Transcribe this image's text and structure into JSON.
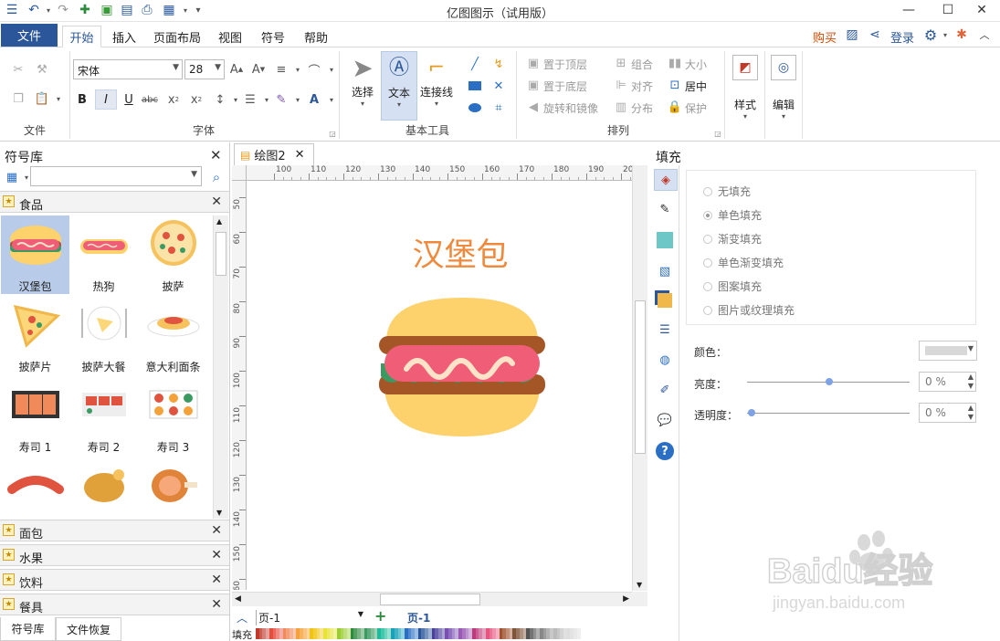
{
  "app": {
    "title": "亿图图示（试用版）"
  },
  "ribbon_tabs": [
    {
      "label": "文件"
    },
    {
      "label": "开始"
    },
    {
      "label": "插入"
    },
    {
      "label": "页面布局"
    },
    {
      "label": "视图"
    },
    {
      "label": "符号"
    },
    {
      "label": "帮助"
    }
  ],
  "header_right": {
    "buy": "购买",
    "login": "登录"
  },
  "groups": {
    "file": "文件",
    "font": "字体",
    "basic_tools": "基本工具",
    "arrange": "排列"
  },
  "font": {
    "family": "宋体",
    "size": "28"
  },
  "tools": {
    "select": "选择",
    "text": "文本",
    "connector": "连接线"
  },
  "arrange": {
    "bring_front": "置于顶层",
    "send_back": "置于底层",
    "rotate": "旋转和镜像",
    "group": "组合",
    "align": "对齐",
    "distribute": "分布",
    "size": "大小",
    "center": "居中",
    "protect": "保护"
  },
  "style_label": "样式",
  "edit_label": "编辑",
  "symbol_library": {
    "title": "符号库",
    "open_category": "食品",
    "items": [
      "汉堡包",
      "热狗",
      "披萨",
      "披萨片",
      "披萨大餐",
      "意大利面条",
      "寿司 1",
      "寿司 2",
      "寿司 3"
    ],
    "collapsed_categories": [
      "面包",
      "水果",
      "饮料",
      "餐具"
    ],
    "bottom_tabs": [
      "符号库",
      "文件恢复"
    ]
  },
  "document": {
    "tab": "绘图2",
    "canvas_title": "汉堡包",
    "ruler_h": [
      "100",
      "110",
      "120",
      "130",
      "140",
      "150",
      "160",
      "170",
      "180",
      "190",
      "200"
    ],
    "ruler_v": [
      "50",
      "60",
      "70",
      "80",
      "90",
      "100",
      "110",
      "120",
      "130",
      "140",
      "150",
      "160"
    ]
  },
  "pagebar": {
    "page_select": "页-1",
    "page_tab": "页-1",
    "fill_label": "填充"
  },
  "fill_panel": {
    "title": "填充",
    "options": [
      "无填充",
      "单色填充",
      "渐变填充",
      "单色渐变填充",
      "图案填充",
      "图片或纹理填充"
    ],
    "selected_option": "单色填充",
    "color_label": "颜色：",
    "brightness_label": "亮度：",
    "brightness_value": "0 %",
    "transparency_label": "透明度：",
    "transparency_value": "0 %"
  },
  "colors": {
    "accent": "#2b579a",
    "buy": "#d04a02",
    "canvas_title": "#ef8a3d",
    "bun": "#fdd26c",
    "bread_shadow": "#a55627",
    "lettuce": "#3a9a62",
    "sausage": "#ef5e76",
    "mustard": "#fde3c7"
  },
  "watermark": {
    "brand": "Baidu经验",
    "url": "jingyan.baidu.com"
  }
}
